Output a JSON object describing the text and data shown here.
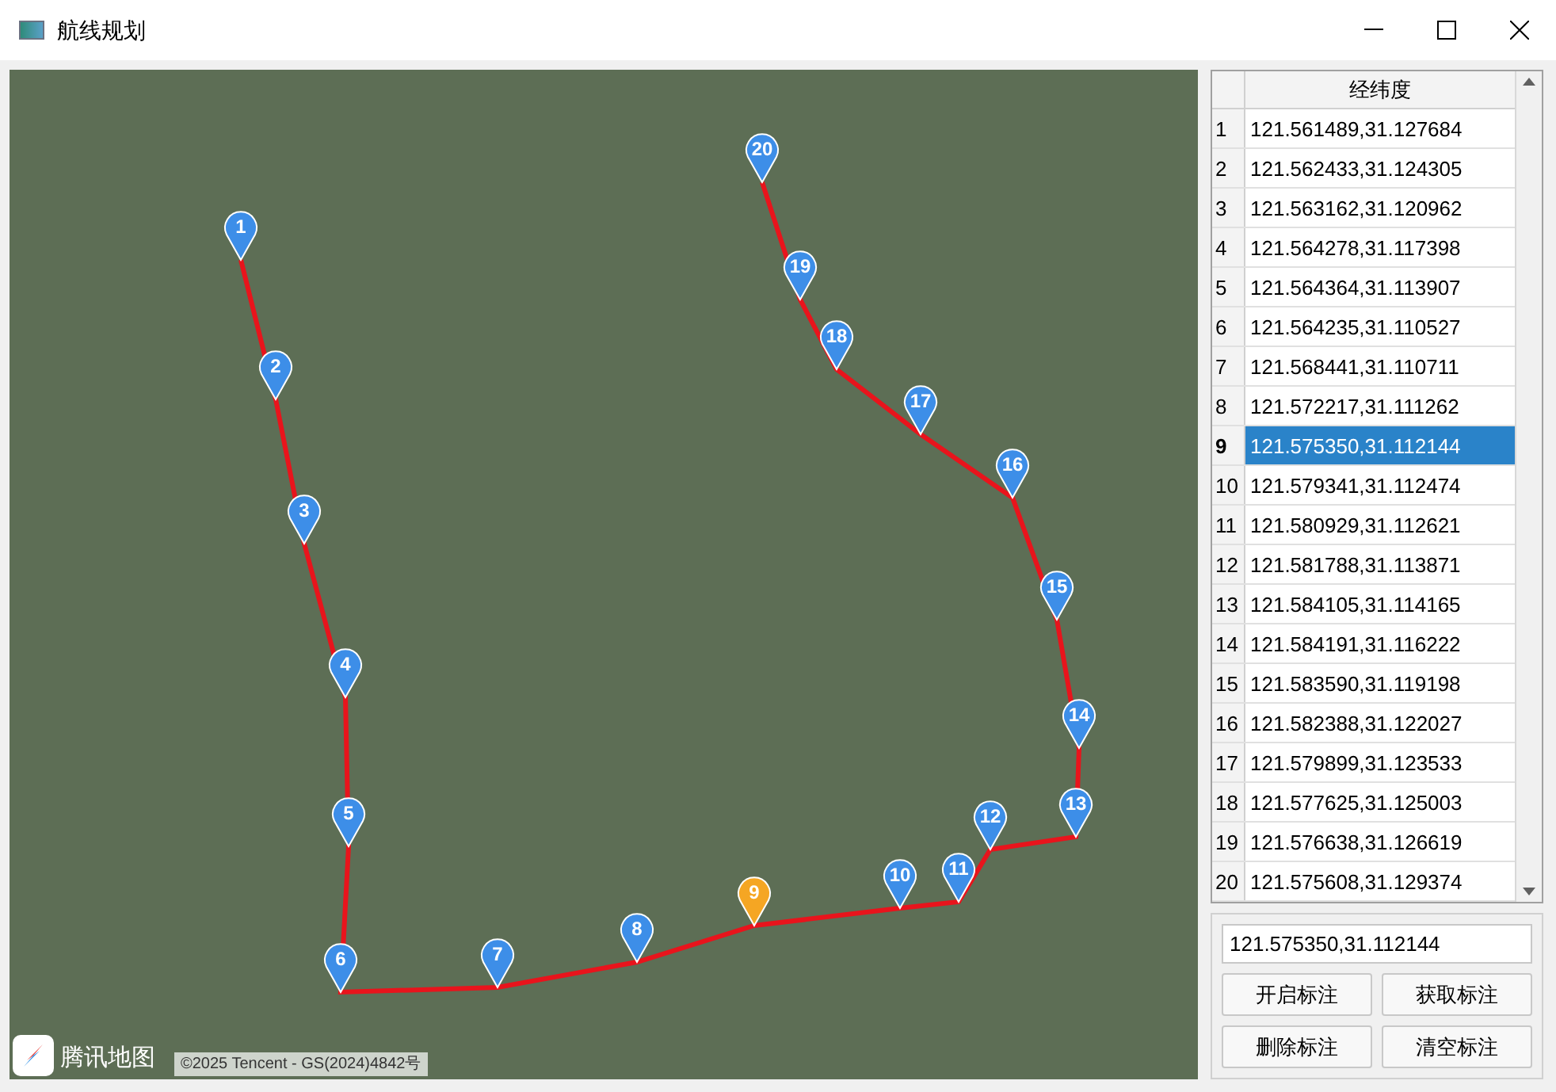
{
  "window": {
    "title": "航线规划"
  },
  "map": {
    "markers": [
      {
        "label": "1",
        "selected": false
      },
      {
        "label": "2",
        "selected": false
      },
      {
        "label": "3",
        "selected": false
      },
      {
        "label": "4",
        "selected": false
      },
      {
        "label": "5",
        "selected": false
      },
      {
        "label": "6",
        "selected": false
      },
      {
        "label": "7",
        "selected": false
      },
      {
        "label": "8",
        "selected": false
      },
      {
        "label": "9",
        "selected": true
      },
      {
        "label": "10",
        "selected": false
      },
      {
        "label": "11",
        "selected": false
      },
      {
        "label": "12",
        "selected": false
      },
      {
        "label": "13",
        "selected": false
      },
      {
        "label": "14",
        "selected": false
      },
      {
        "label": "15",
        "selected": false
      },
      {
        "label": "16",
        "selected": false
      },
      {
        "label": "17",
        "selected": false
      },
      {
        "label": "18",
        "selected": false
      },
      {
        "label": "19",
        "selected": false
      },
      {
        "label": "20",
        "selected": false
      }
    ],
    "logo_text": "腾讯地图",
    "copyright": "©2025 Tencent - GS(2024)4842号"
  },
  "table": {
    "columns": [
      "经纬度"
    ],
    "rows": [
      {
        "index": "1",
        "value": "121.561489,31.127684",
        "selected": false
      },
      {
        "index": "2",
        "value": "121.562433,31.124305",
        "selected": false
      },
      {
        "index": "3",
        "value": "121.563162,31.120962",
        "selected": false
      },
      {
        "index": "4",
        "value": "121.564278,31.117398",
        "selected": false
      },
      {
        "index": "5",
        "value": "121.564364,31.113907",
        "selected": false
      },
      {
        "index": "6",
        "value": "121.564235,31.110527",
        "selected": false
      },
      {
        "index": "7",
        "value": "121.568441,31.110711",
        "selected": false
      },
      {
        "index": "8",
        "value": "121.572217,31.111262",
        "selected": false
      },
      {
        "index": "9",
        "value": "121.575350,31.112144",
        "selected": true
      },
      {
        "index": "10",
        "value": "121.579341,31.112474",
        "selected": false
      },
      {
        "index": "11",
        "value": "121.580929,31.112621",
        "selected": false
      },
      {
        "index": "12",
        "value": "121.581788,31.113871",
        "selected": false
      },
      {
        "index": "13",
        "value": "121.584105,31.114165",
        "selected": false
      },
      {
        "index": "14",
        "value": "121.584191,31.116222",
        "selected": false
      },
      {
        "index": "15",
        "value": "121.583590,31.119198",
        "selected": false
      },
      {
        "index": "16",
        "value": "121.582388,31.122027",
        "selected": false
      },
      {
        "index": "17",
        "value": "121.579899,31.123533",
        "selected": false
      },
      {
        "index": "18",
        "value": "121.577625,31.125003",
        "selected": false
      },
      {
        "index": "19",
        "value": "121.576638,31.126619",
        "selected": false
      },
      {
        "index": "20",
        "value": "121.575608,31.129374",
        "selected": false
      }
    ]
  },
  "coordinate_field": {
    "value": "121.575350,31.112144"
  },
  "buttons": [
    "开启标注",
    "获取标注",
    "删除标注",
    "清空标注"
  ]
}
